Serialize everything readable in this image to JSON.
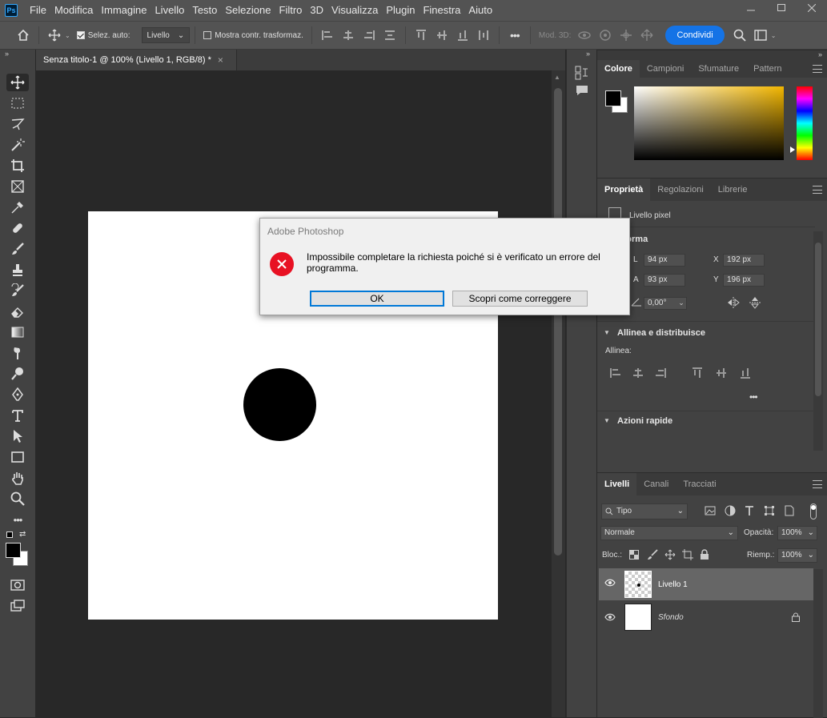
{
  "menubar": {
    "logo": "Ps",
    "items": [
      "File",
      "Modifica",
      "Immagine",
      "Livello",
      "Testo",
      "Selezione",
      "Filtro",
      "3D",
      "Visualizza",
      "Plugin",
      "Finestra",
      "Aiuto"
    ]
  },
  "optbar": {
    "auto_select_label": "Selez. auto:",
    "auto_select_value": "Livello",
    "transform_label": "Mostra contr. trasformaz.",
    "mode3d_label": "Mod. 3D:",
    "share_label": "Condividi"
  },
  "document_tab": {
    "title": "Senza titolo-1 @ 100% (Livello 1, RGB/8) *",
    "close": "×"
  },
  "collapse": "»",
  "color_panel": {
    "tabs": [
      "Colore",
      "Campioni",
      "Sfumature",
      "Pattern"
    ]
  },
  "properties_panel": {
    "tabs": [
      "Proprietà",
      "Regolazioni",
      "Librerie"
    ],
    "layer_type": "Livello pixel",
    "transform_title": "Trasforma",
    "w_label": "L",
    "w_value": "94 px",
    "h_label": "A",
    "h_value": "93 px",
    "x_label": "X",
    "x_value": "192 px",
    "y_label": "Y",
    "y_value": "196 px",
    "angle_value": "0,00°",
    "align_title": "Allinea e distribuisce",
    "align_label": "Allinea:",
    "more": "•••",
    "quick_actions_title": "Azioni rapide"
  },
  "layers_panel": {
    "tabs": [
      "Livelli",
      "Canali",
      "Tracciati"
    ],
    "filter_value": "Tipo",
    "blend_mode": "Normale",
    "opacity_label": "Opacità:",
    "opacity_value": "100%",
    "lock_label": "Bloc.:",
    "fill_label": "Riemp.:",
    "fill_value": "100%",
    "layers": [
      {
        "name": "Livello 1"
      },
      {
        "name": "Sfondo"
      }
    ]
  },
  "dialog": {
    "title": "Adobe Photoshop",
    "message": "Impossibile completare la richiesta poiché si è verificato un errore del programma.",
    "ok_label": "OK",
    "fix_label": "Scopri come correggere"
  },
  "colors": {
    "accent": "#1473e6",
    "error": "#e81123",
    "panel": "#424242",
    "workspace": "#282828"
  }
}
